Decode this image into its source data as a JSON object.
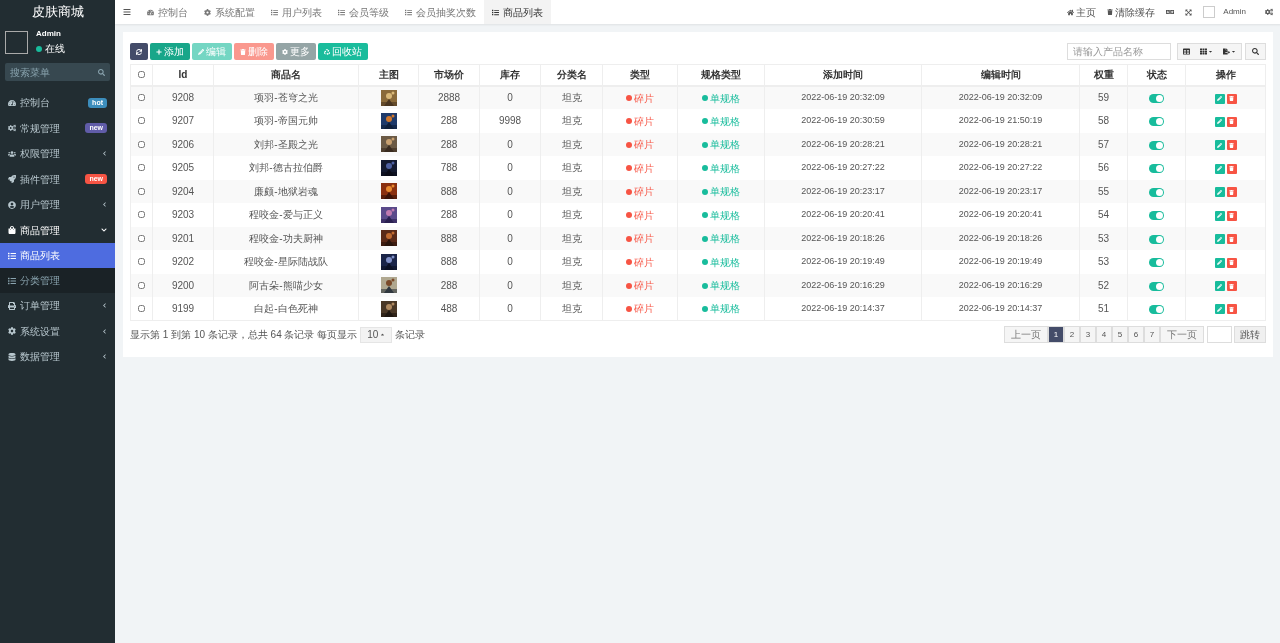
{
  "sidebar": {
    "title": "皮肤商城",
    "user": {
      "name": "Admin",
      "status": "在线"
    },
    "search": {
      "placeholder": "搜索菜单"
    },
    "items": [
      {
        "label": "控制台",
        "badge": {
          "text": "hot",
          "color": "#3c8dbc"
        }
      },
      {
        "label": "常规管理",
        "badge": {
          "text": "new",
          "color": "#605ca8"
        }
      },
      {
        "label": "权限管理",
        "expanded": false
      },
      {
        "label": "插件管理",
        "badge": {
          "text": "new",
          "color": "#f75444"
        }
      },
      {
        "label": "用户管理",
        "expanded": false
      },
      {
        "label": "商品管理",
        "expanded": true,
        "children": [
          {
            "label": "商品列表",
            "selected": true
          },
          {
            "label": "分类管理",
            "selected": false
          }
        ]
      },
      {
        "label": "订单管理",
        "expanded": false
      },
      {
        "label": "系统设置",
        "expanded": false
      },
      {
        "label": "数据管理",
        "expanded": false
      }
    ]
  },
  "tabs": [
    {
      "label": "控制台",
      "selected": false
    },
    {
      "label": "系统配置",
      "selected": false
    },
    {
      "label": "用户列表",
      "selected": false
    },
    {
      "label": "会员等级",
      "selected": false
    },
    {
      "label": "会员抽奖次数",
      "selected": false
    },
    {
      "label": "商品列表",
      "selected": true
    }
  ],
  "topbar": {
    "links": [
      "主页",
      "清除缓存"
    ],
    "user": "Admin"
  },
  "toolbar": {
    "buttons": [
      {
        "kind": "primary",
        "disabled": false
      },
      {
        "kind": "success",
        "label": "添加",
        "disabled": false
      },
      {
        "kind": "success-light",
        "label": "编辑",
        "disabled": true
      },
      {
        "kind": "danger",
        "label": "删除",
        "disabled": true
      },
      {
        "kind": "info",
        "label": "更多",
        "disabled": false
      },
      {
        "kind": "teal",
        "label": "回收站",
        "disabled": false
      }
    ],
    "search": {
      "placeholder": "请输入产品名称"
    }
  },
  "table": {
    "select_all": false,
    "columns": [
      "Id",
      "商品名",
      "主图",
      "市场价",
      "库存",
      "分类名",
      "类型",
      "规格类型",
      "添加时间",
      "编辑时间",
      "权重",
      "状态",
      "操作"
    ],
    "rows": [
      {
        "checked": false,
        "id": "9208",
        "name": "项羽-苍穹之光",
        "price": "2888",
        "stock": "0",
        "category": "坦克",
        "type": "碎片",
        "spec": "单规格",
        "added": "2022-06-19 20:32:09",
        "edited": "2022-06-19 20:32:09",
        "weight": "59",
        "enabled": true
      },
      {
        "checked": false,
        "id": "9207",
        "name": "项羽-帝国元帅",
        "price": "288",
        "stock": "9998",
        "category": "坦克",
        "type": "碎片",
        "spec": "单规格",
        "added": "2022-06-19 20:30:59",
        "edited": "2022-06-19 21:50:19",
        "weight": "58",
        "enabled": true
      },
      {
        "checked": false,
        "id": "9206",
        "name": "刘邦-圣殿之光",
        "price": "288",
        "stock": "0",
        "category": "坦克",
        "type": "碎片",
        "spec": "单规格",
        "added": "2022-06-19 20:28:21",
        "edited": "2022-06-19 20:28:21",
        "weight": "57",
        "enabled": true
      },
      {
        "checked": false,
        "id": "9205",
        "name": "刘邦-德古拉伯爵",
        "price": "788",
        "stock": "0",
        "category": "坦克",
        "type": "碎片",
        "spec": "单规格",
        "added": "2022-06-19 20:27:22",
        "edited": "2022-06-19 20:27:22",
        "weight": "56",
        "enabled": true
      },
      {
        "checked": false,
        "id": "9204",
        "name": "廉颇-地狱岩魂",
        "price": "888",
        "stock": "0",
        "category": "坦克",
        "type": "碎片",
        "spec": "单规格",
        "added": "2022-06-19 20:23:17",
        "edited": "2022-06-19 20:23:17",
        "weight": "55",
        "enabled": true
      },
      {
        "checked": false,
        "id": "9203",
        "name": "程咬金-爱与正义",
        "price": "288",
        "stock": "0",
        "category": "坦克",
        "type": "碎片",
        "spec": "单规格",
        "added": "2022-06-19 20:20:41",
        "edited": "2022-06-19 20:20:41",
        "weight": "54",
        "enabled": true
      },
      {
        "checked": false,
        "id": "9201",
        "name": "程咬金-功夫厨神",
        "price": "888",
        "stock": "0",
        "category": "坦克",
        "type": "碎片",
        "spec": "单规格",
        "added": "2022-06-19 20:18:26",
        "edited": "2022-06-19 20:18:26",
        "weight": "53",
        "enabled": true
      },
      {
        "checked": false,
        "id": "9202",
        "name": "程咬金-星际陆战队",
        "price": "888",
        "stock": "0",
        "category": "坦克",
        "type": "碎片",
        "spec": "单规格",
        "added": "2022-06-19 20:19:49",
        "edited": "2022-06-19 20:19:49",
        "weight": "53",
        "enabled": true
      },
      {
        "checked": false,
        "id": "9200",
        "name": "阿古朵-熊喵少女",
        "price": "288",
        "stock": "0",
        "category": "坦克",
        "type": "碎片",
        "spec": "单规格",
        "added": "2022-06-19 20:16:29",
        "edited": "2022-06-19 20:16:29",
        "weight": "52",
        "enabled": true
      },
      {
        "checked": false,
        "id": "9199",
        "name": "白起-白色死神",
        "price": "488",
        "stock": "0",
        "category": "坦克",
        "type": "碎片",
        "spec": "单规格",
        "added": "2022-06-19 20:14:37",
        "edited": "2022-06-19 20:14:37",
        "weight": "51",
        "enabled": true
      }
    ]
  },
  "footer": {
    "summary": "显示第 1 到第 10 条记录，总共 64 条记录 每页显示",
    "page_size": "10",
    "suffix": "条记录"
  },
  "pagination": {
    "prev": "上一页",
    "pages": [
      {
        "label": "1",
        "selected": true
      },
      {
        "label": "2",
        "selected": false
      },
      {
        "label": "3",
        "selected": false
      },
      {
        "label": "4",
        "selected": false
      },
      {
        "label": "5",
        "selected": false
      },
      {
        "label": "6",
        "selected": false
      },
      {
        "label": "7",
        "selected": false
      }
    ],
    "next": "下一页",
    "jump": "跳转"
  }
}
